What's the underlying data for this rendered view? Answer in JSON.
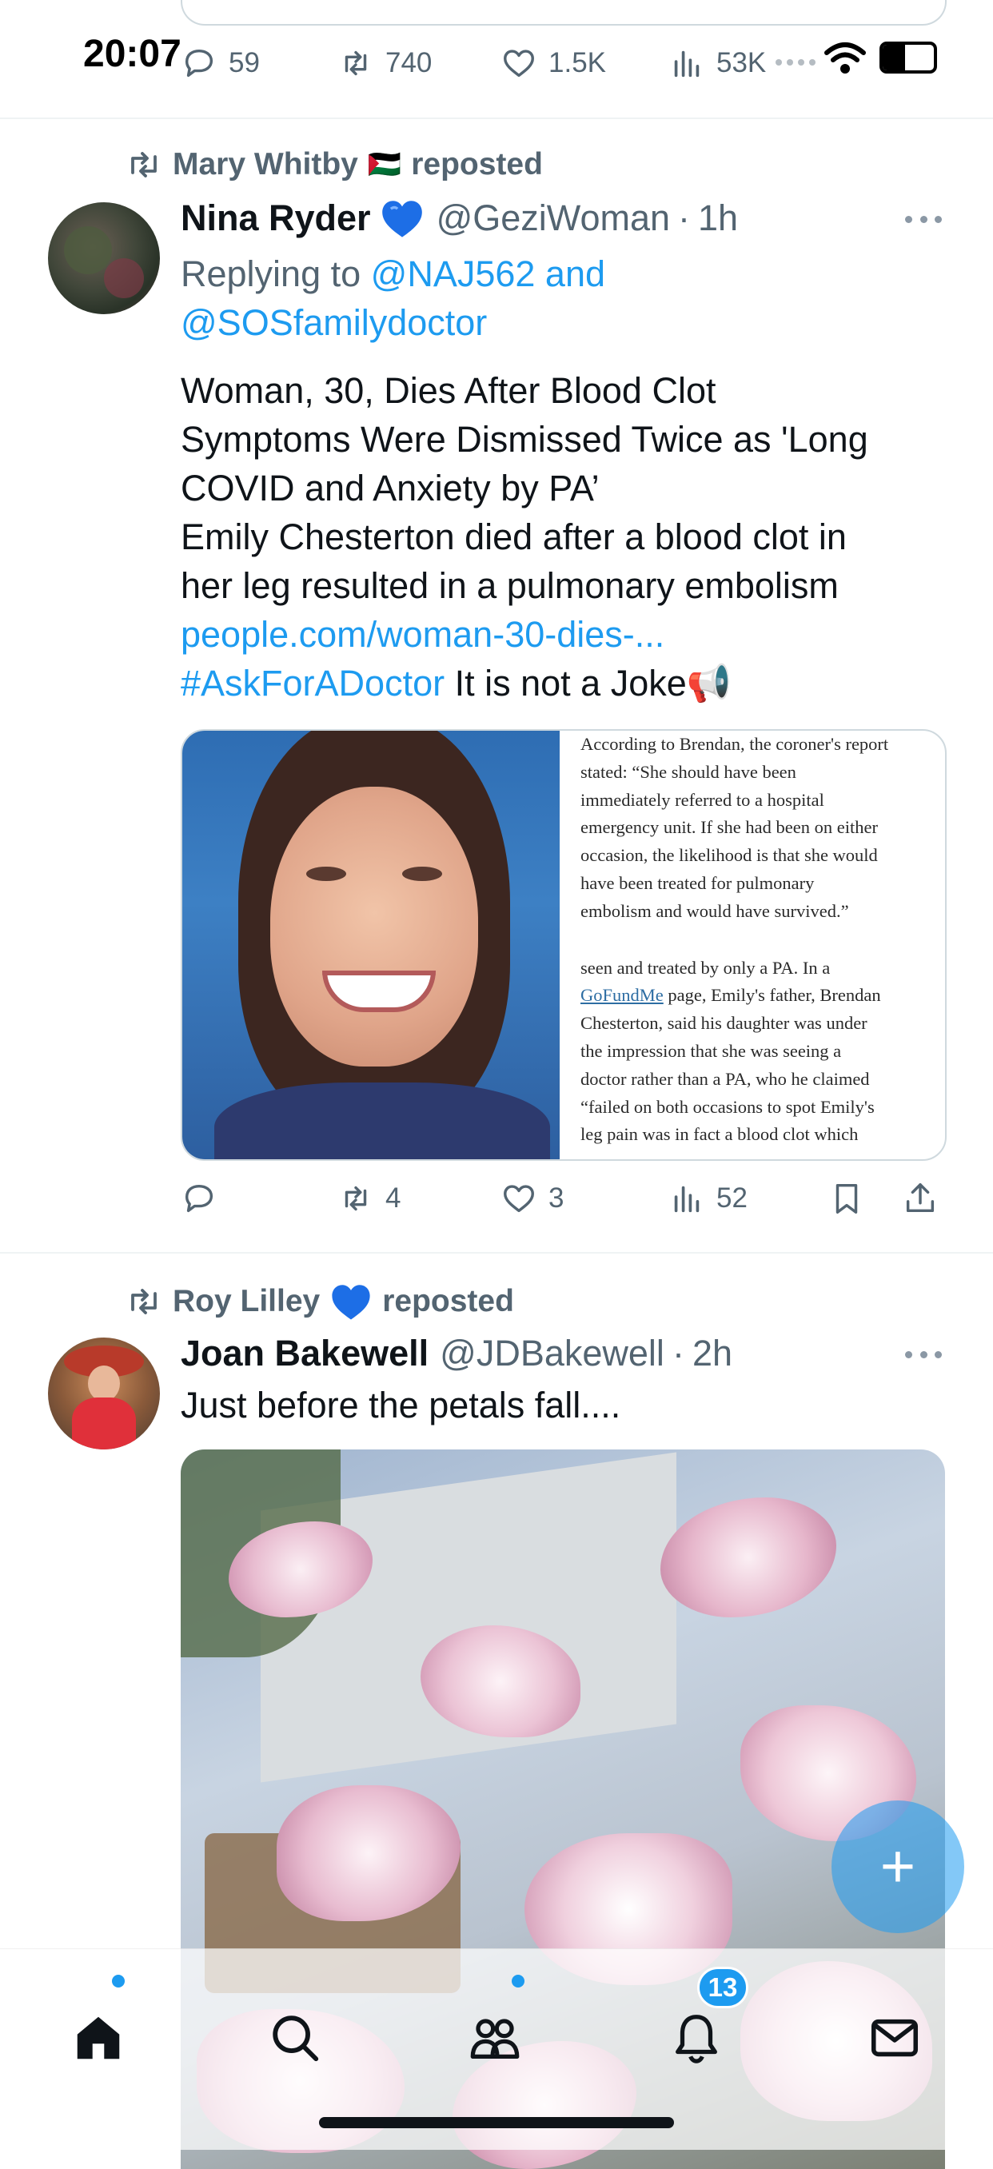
{
  "status_bar": {
    "time": "20:07"
  },
  "prev_tweet": {
    "actions": {
      "replies": "59",
      "reposts": "740",
      "likes": "1.5K",
      "views": "53K"
    }
  },
  "tweet1": {
    "repost_by": "Mary Whitby",
    "repost_flag": "🇵🇸",
    "repost_label": "reposted",
    "author_name": "Nina Ryder",
    "author_handle": "@GeziWoman",
    "time": "1h",
    "reply_prefix": "Replying to",
    "reply_to_1": "@NAJ562 and",
    "reply_to_2": "@SOSfamilydoctor",
    "lines": [
      "Woman, 30, Dies After Blood Clot",
      "Symptoms Were Dismissed Twice as 'Long",
      "COVID and Anxiety by PA’",
      "Emily Chesterton died after a blood clot in",
      "her leg resulted in a pulmonary embolism"
    ],
    "link": "people.com/woman-30-dies-...",
    "hashtag": "#AskForADoctor",
    "trailing_text": " It is not a Joke",
    "trailing_emoji": "📢",
    "article_lines_a": [
      "According to Brendan, the coroner's report",
      "stated: “She should have been",
      "immediately referred to a hospital",
      "emergency unit. If she had been on either",
      "occasion, the likelihood is that she would",
      "have been treated for pulmonary",
      "embolism and would have survived.”"
    ],
    "article_line_b1": "seen and treated by only a PA. In a",
    "article_link": "GoFundMe",
    "article_line_b2_rest": " page, Emily's father, Brendan",
    "article_lines_c": [
      "Chesterton, said his daughter was under",
      "the impression that she was seeing a",
      "doctor rather than a PA, who he claimed",
      "“failed on both occasions to spot Emily's",
      "leg pain was in fact a blood clot which"
    ],
    "actions": {
      "replies": "",
      "reposts": "4",
      "likes": "3",
      "views": "52"
    }
  },
  "tweet2": {
    "repost_by": "Roy Lilley",
    "repost_label": "reposted",
    "author_name": "Joan Bakewell",
    "author_handle": "@JDBakewell",
    "time": "2h",
    "text": "Just before the petals fall...."
  },
  "fab": {
    "label": "+"
  },
  "tabbar": {
    "notifications_badge": "13"
  },
  "colors": {
    "accent": "#1d9bf0",
    "verified": "#1d6ee6",
    "text": "#0f1419",
    "muted": "#536471"
  }
}
